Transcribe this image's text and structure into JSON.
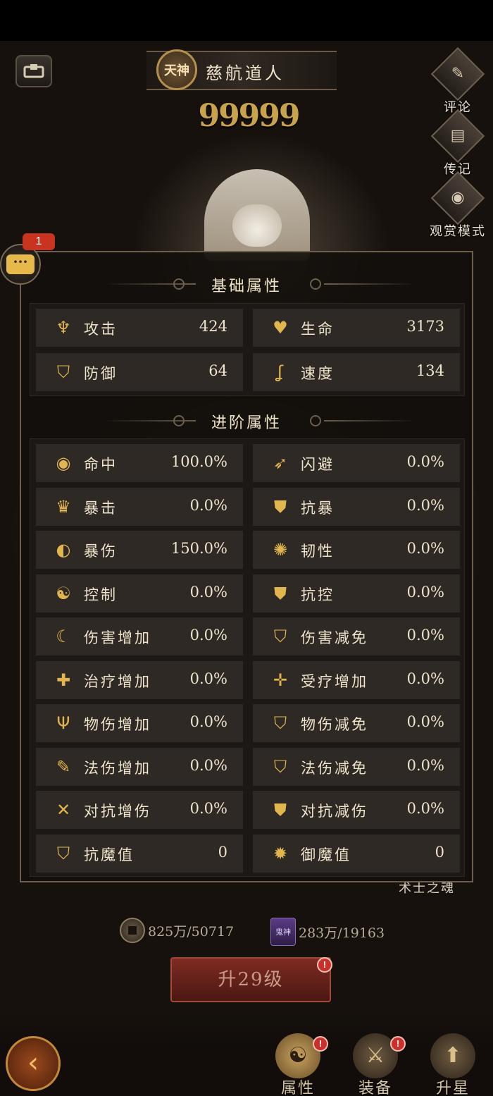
{
  "header": {
    "god_badge": "天神",
    "character_name": "慈航道人",
    "power": "99999"
  },
  "side_buttons": [
    {
      "label": "评论",
      "icon": "comment-icon"
    },
    {
      "label": "传记",
      "icon": "biography-icon"
    },
    {
      "label": "观赏模式",
      "icon": "camera-icon"
    }
  ],
  "chat": {
    "badge_count": "1"
  },
  "basic": {
    "title": "基础属性",
    "stats": [
      {
        "label": "攻击",
        "value": "424",
        "icon": "attack-icon"
      },
      {
        "label": "生命",
        "value": "3173",
        "icon": "heart-icon"
      },
      {
        "label": "防御",
        "value": "64",
        "icon": "defense-icon"
      },
      {
        "label": "速度",
        "value": "134",
        "icon": "speed-icon"
      }
    ]
  },
  "advanced": {
    "title": "进阶属性",
    "stats": [
      {
        "label": "命中",
        "value": "100.0%",
        "icon": "eye-icon"
      },
      {
        "label": "闪避",
        "value": "0.0%",
        "icon": "dodge-icon"
      },
      {
        "label": "暴击",
        "value": "0.0%",
        "icon": "crit-icon"
      },
      {
        "label": "抗暴",
        "value": "0.0%",
        "icon": "crit-resist-icon"
      },
      {
        "label": "暴伤",
        "value": "150.0%",
        "icon": "crit-damage-icon"
      },
      {
        "label": "韧性",
        "value": "0.0%",
        "icon": "tenacity-icon"
      },
      {
        "label": "控制",
        "value": "0.0%",
        "icon": "control-icon"
      },
      {
        "label": "抗控",
        "value": "0.0%",
        "icon": "control-resist-icon"
      },
      {
        "label": "伤害增加",
        "value": "0.0%",
        "icon": "damage-up-icon"
      },
      {
        "label": "伤害减免",
        "value": "0.0%",
        "icon": "damage-reduce-icon"
      },
      {
        "label": "治疗增加",
        "value": "0.0%",
        "icon": "heal-up-icon"
      },
      {
        "label": "受疗增加",
        "value": "0.0%",
        "icon": "heal-received-icon"
      },
      {
        "label": "物伤增加",
        "value": "0.0%",
        "icon": "physical-up-icon"
      },
      {
        "label": "物伤减免",
        "value": "0.0%",
        "icon": "physical-reduce-icon"
      },
      {
        "label": "法伤增加",
        "value": "0.0%",
        "icon": "magic-up-icon"
      },
      {
        "label": "法伤减免",
        "value": "0.0%",
        "icon": "magic-reduce-icon"
      },
      {
        "label": "对抗增伤",
        "value": "0.0%",
        "icon": "pvp-up-icon"
      },
      {
        "label": "对抗减伤",
        "value": "0.0%",
        "icon": "pvp-reduce-icon"
      },
      {
        "label": "抗魔值",
        "value": "0",
        "icon": "anti-demon-icon"
      },
      {
        "label": "御魔值",
        "value": "0",
        "icon": "ward-demon-icon"
      }
    ]
  },
  "soul_label": "术士之魂",
  "resources": {
    "coins": "825万/50717",
    "book_icon_text": "鬼神",
    "books": "283万/19163"
  },
  "upgrade": {
    "label": "升29级",
    "alert": "!"
  },
  "bottom_nav": [
    {
      "label": "属性",
      "glyph": "☯",
      "active": true,
      "alert": "!"
    },
    {
      "label": "装备",
      "glyph": "⚔",
      "active": false,
      "alert": "!"
    },
    {
      "label": "升星",
      "glyph": "⬆",
      "active": false,
      "alert": ""
    }
  ],
  "colors": {
    "gold": "#e2b64e",
    "panel_border": "#6e5f4c",
    "cell_bg": "#2f2925",
    "alert_red": "#c9302c"
  }
}
